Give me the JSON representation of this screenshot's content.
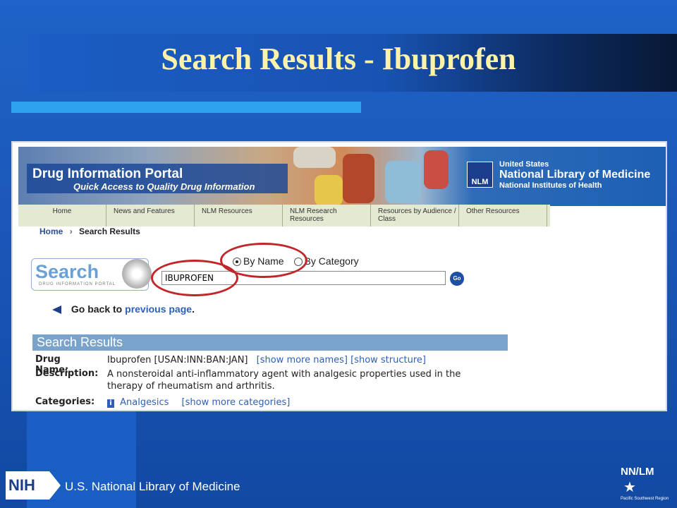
{
  "slide": {
    "title": "Search Results - Ibuprofen",
    "footer_org": "U.S. National Library of Medicine",
    "nih_mark": "NIH",
    "nnlm_mark": "NN/LM",
    "nnlm_region": "Pacific Southwest Region"
  },
  "portal": {
    "name": "Drug Information Portal",
    "tagline": "Quick Access to Quality Drug Information",
    "agency_line1": "United States",
    "agency_line2": "National Library of Medicine",
    "agency_line3": "National Institutes of Health",
    "agency_logo": "NLM"
  },
  "nav": {
    "items": [
      {
        "label": "Home"
      },
      {
        "label": "News and Features"
      },
      {
        "label": "NLM Resources"
      },
      {
        "label": "NLM Research Resources"
      },
      {
        "label": "Resources by Audience / Class"
      },
      {
        "label": "Other Resources"
      }
    ]
  },
  "breadcrumb": {
    "home": "Home",
    "separator": "›",
    "current": "Search Results"
  },
  "search": {
    "logo_word": "Search",
    "logo_sub": "DRUG INFORMATION PORTAL",
    "radio_name": "By Name",
    "radio_category": "By Category",
    "radio_selected": "By Name",
    "query": "IBUPROFEN",
    "go_label": "Go"
  },
  "back": {
    "prefix": "Go back to",
    "link": "previous page",
    "suffix": "."
  },
  "results": {
    "header": "Search Results",
    "drug_label": "Drug Name:",
    "drug_value": "Ibuprofen [USAN:INN:BAN:JAN]",
    "show_more_names": "[show more names]",
    "show_structure": "[show structure]",
    "description_label": "Description:",
    "description_value": "A nonsteroidal anti-inflammatory agent with analgesic properties used in the therapy of rheumatism and arthritis.",
    "categories_label": "Categories:",
    "category": "Analgesics",
    "show_more_categories": "[show more categories]"
  },
  "colors": {
    "title": "#fdf2a8",
    "annotation_ring": "#c0262a",
    "results_header": "#7aa3cc",
    "link": "#2e5fb8"
  }
}
